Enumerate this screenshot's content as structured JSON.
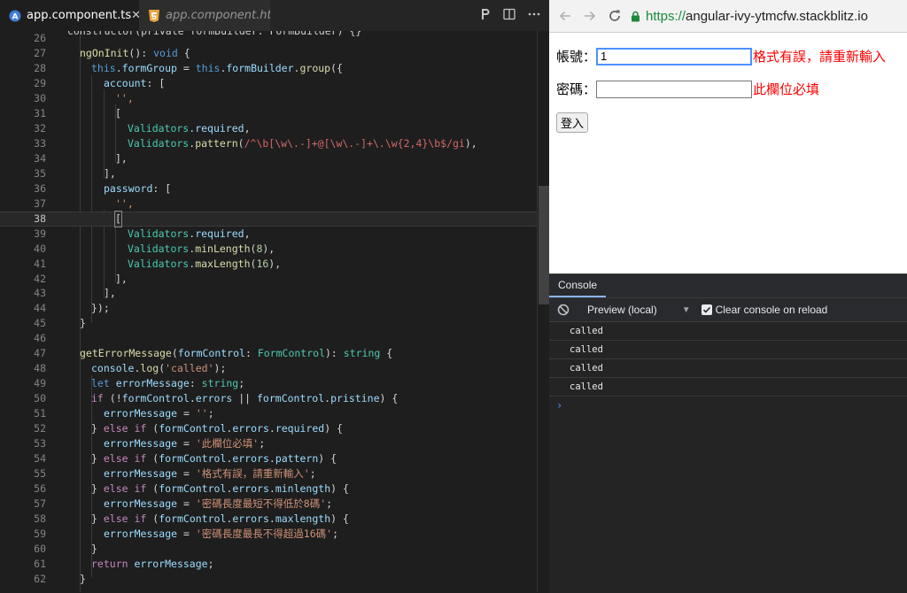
{
  "editor": {
    "tabs": [
      {
        "label": "app.component.ts",
        "active": true
      },
      {
        "label": "app.component.html",
        "active": false
      }
    ],
    "toolbar_icons": [
      "preview-icon",
      "split-editor-icon",
      "more-icon"
    ],
    "lines": [
      {
        "n": "26",
        "text": "constructor(private formBuilder: FormBuilder) {}"
      },
      {
        "n": "27",
        "text": "ngOnInit(): void {"
      },
      {
        "n": "28",
        "text": "this.formGroup = this.formBuilder.group({"
      },
      {
        "n": "29",
        "text": "account: ["
      },
      {
        "n": "30",
        "text": "'',"
      },
      {
        "n": "31",
        "text": "["
      },
      {
        "n": "32",
        "text": "Validators.required,"
      },
      {
        "n": "33",
        "text": "Validators.pattern(/^\\b[\\w\\.-]+@[\\w\\.-]+\\.\\w{2,4}\\b$/gi),"
      },
      {
        "n": "34",
        "text": "],"
      },
      {
        "n": "35",
        "text": "],"
      },
      {
        "n": "36",
        "text": "password: ["
      },
      {
        "n": "37",
        "text": "'',"
      },
      {
        "n": "38",
        "text": "["
      },
      {
        "n": "39",
        "text": "Validators.required,"
      },
      {
        "n": "40",
        "text": "Validators.minLength(8),"
      },
      {
        "n": "41",
        "text": "Validators.maxLength(16),"
      },
      {
        "n": "42",
        "text": "],"
      },
      {
        "n": "43",
        "text": "],"
      },
      {
        "n": "44",
        "text": "});"
      },
      {
        "n": "45",
        "text": "}"
      },
      {
        "n": "46",
        "text": ""
      },
      {
        "n": "47",
        "text": "getErrorMessage(formControl: FormControl): string {"
      },
      {
        "n": "48",
        "text": "console.log('called');"
      },
      {
        "n": "49",
        "text": "let errorMessage: string;"
      },
      {
        "n": "50",
        "text": "if (!formControl.errors || formControl.pristine) {"
      },
      {
        "n": "51",
        "text": "errorMessage = '';"
      },
      {
        "n": "52",
        "text": "} else if (formControl.errors.required) {"
      },
      {
        "n": "53",
        "text": "errorMessage = '此欄位必填';"
      },
      {
        "n": "54",
        "text": "} else if (formControl.errors.pattern) {"
      },
      {
        "n": "55",
        "text": "errorMessage = '格式有誤，請重新輸入';"
      },
      {
        "n": "56",
        "text": "} else if (formControl.errors.minlength) {"
      },
      {
        "n": "57",
        "text": "errorMessage = '密碼長度最短不得低於8碼';"
      },
      {
        "n": "58",
        "text": "} else if (formControl.errors.maxlength) {"
      },
      {
        "n": "59",
        "text": "errorMessage = '密碼長度最長不得超過16碼';"
      },
      {
        "n": "60",
        "text": "}"
      },
      {
        "n": "61",
        "text": "return errorMessage;"
      },
      {
        "n": "62",
        "text": "}"
      }
    ]
  },
  "browser": {
    "url_prefix": "https://",
    "url_host": "angular-ivy-ytmcfw.stackblitz.io",
    "form": {
      "account_label": "帳號：",
      "account_value": "1",
      "account_error": "格式有誤，請重新輸入",
      "password_label": "密碼：",
      "password_value": "",
      "password_error": "此欄位必填",
      "login_button": "登入"
    }
  },
  "devtools": {
    "tab": "Console",
    "context": "Preview (local)",
    "clear_on_reload_label": "Clear console on reload",
    "clear_on_reload_checked": true,
    "logs": [
      "called",
      "called",
      "called",
      "called"
    ],
    "prompt": "›"
  }
}
